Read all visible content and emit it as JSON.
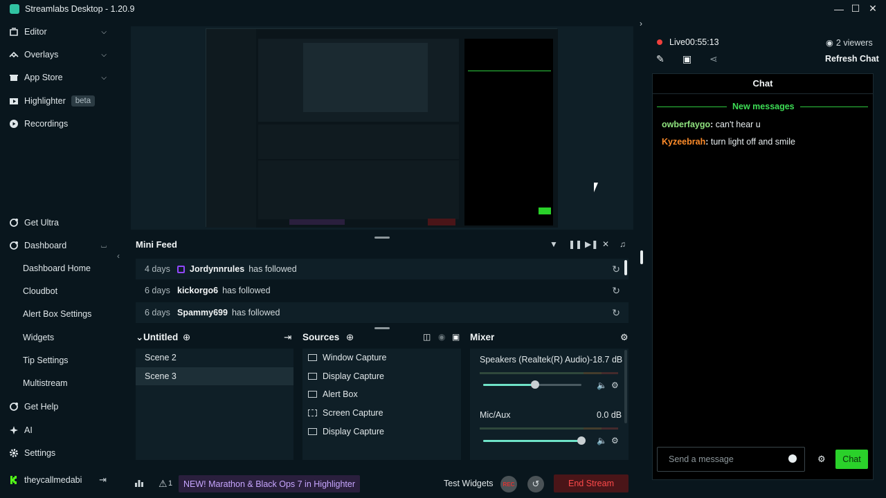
{
  "window": {
    "title": "Streamlabs Desktop - 1.20.9",
    "controls": {
      "minimize": "—",
      "maximize": "☐",
      "close": "✕"
    }
  },
  "sidebar": {
    "top_items": [
      {
        "label": "Editor",
        "icon": "editor-icon"
      },
      {
        "label": "Overlays",
        "icon": "overlays-icon"
      },
      {
        "label": "App Store",
        "icon": "app-store-icon"
      },
      {
        "label": "Highlighter",
        "icon": "highlighter-icon",
        "badge": "beta"
      },
      {
        "label": "Recordings",
        "icon": "recordings-icon"
      }
    ],
    "bottom_items": {
      "get_ultra": "Get Ultra",
      "dashboard": "Dashboard",
      "dashboard_sub": [
        "Dashboard Home",
        "Cloudbot",
        "Alert Box Settings",
        "Widgets",
        "Tip Settings",
        "Multistream"
      ],
      "get_help": "Get Help",
      "ai": "AI",
      "settings": "Settings",
      "account": "theycallmedabi"
    }
  },
  "mini_feed": {
    "title": "Mini Feed",
    "events": [
      {
        "time": "4 days",
        "name": "Jordynnrules",
        "action": "has followed",
        "platform": "twitch"
      },
      {
        "time": "6 days",
        "name": "kickorgo6",
        "action": "has followed",
        "platform": ""
      },
      {
        "time": "6 days",
        "name": "Spammy699",
        "action": "has followed",
        "platform": ""
      }
    ]
  },
  "scenes": {
    "title": "Untitled",
    "items": [
      {
        "label": "Scene 2",
        "selected": false
      },
      {
        "label": "Scene 3",
        "selected": true
      }
    ]
  },
  "sources": {
    "title": "Sources",
    "items": [
      {
        "label": "Window Capture",
        "icon": "window-capture-icon"
      },
      {
        "label": "Display Capture",
        "icon": "display-capture-icon"
      },
      {
        "label": "Alert Box",
        "icon": "alert-box-icon"
      },
      {
        "label": "Screen Capture",
        "icon": "screen-capture-icon"
      },
      {
        "label": "Display Capture",
        "icon": "display-capture-icon"
      }
    ]
  },
  "mixer": {
    "title": "Mixer",
    "channels": [
      {
        "name": "Speakers (Realtek(R) Audio)",
        "db": "-18.7 dB",
        "level": 0.53
      },
      {
        "name": "Mic/Aux",
        "db": "0.0 dB",
        "level": 1.0
      }
    ]
  },
  "footer": {
    "news": "NEW! Marathon & Black Ops 7 in Highlighter",
    "alert_count": "1",
    "test_widgets": "Test Widgets",
    "rec": "REC",
    "end_stream": "End Stream"
  },
  "chat_panel": {
    "live_label": "Live",
    "live_time": "00:55:13",
    "viewers": "2 viewers",
    "refresh": "Refresh Chat",
    "header": "Chat",
    "new_messages": "New messages",
    "messages": [
      {
        "user": "owberfaygo",
        "text": " can't hear u",
        "color": "#8fe37f"
      },
      {
        "user": "Kyzeebrah",
        "text": " turn light off and smile",
        "color": "#ff8c2a"
      }
    ],
    "input_placeholder": "Send a message",
    "send_label": "Chat"
  },
  "colors": {
    "accent": "#31c3a2",
    "live": "#f0403c",
    "chat_button": "#2ad12a",
    "end_stream": "#ff4a4a"
  }
}
